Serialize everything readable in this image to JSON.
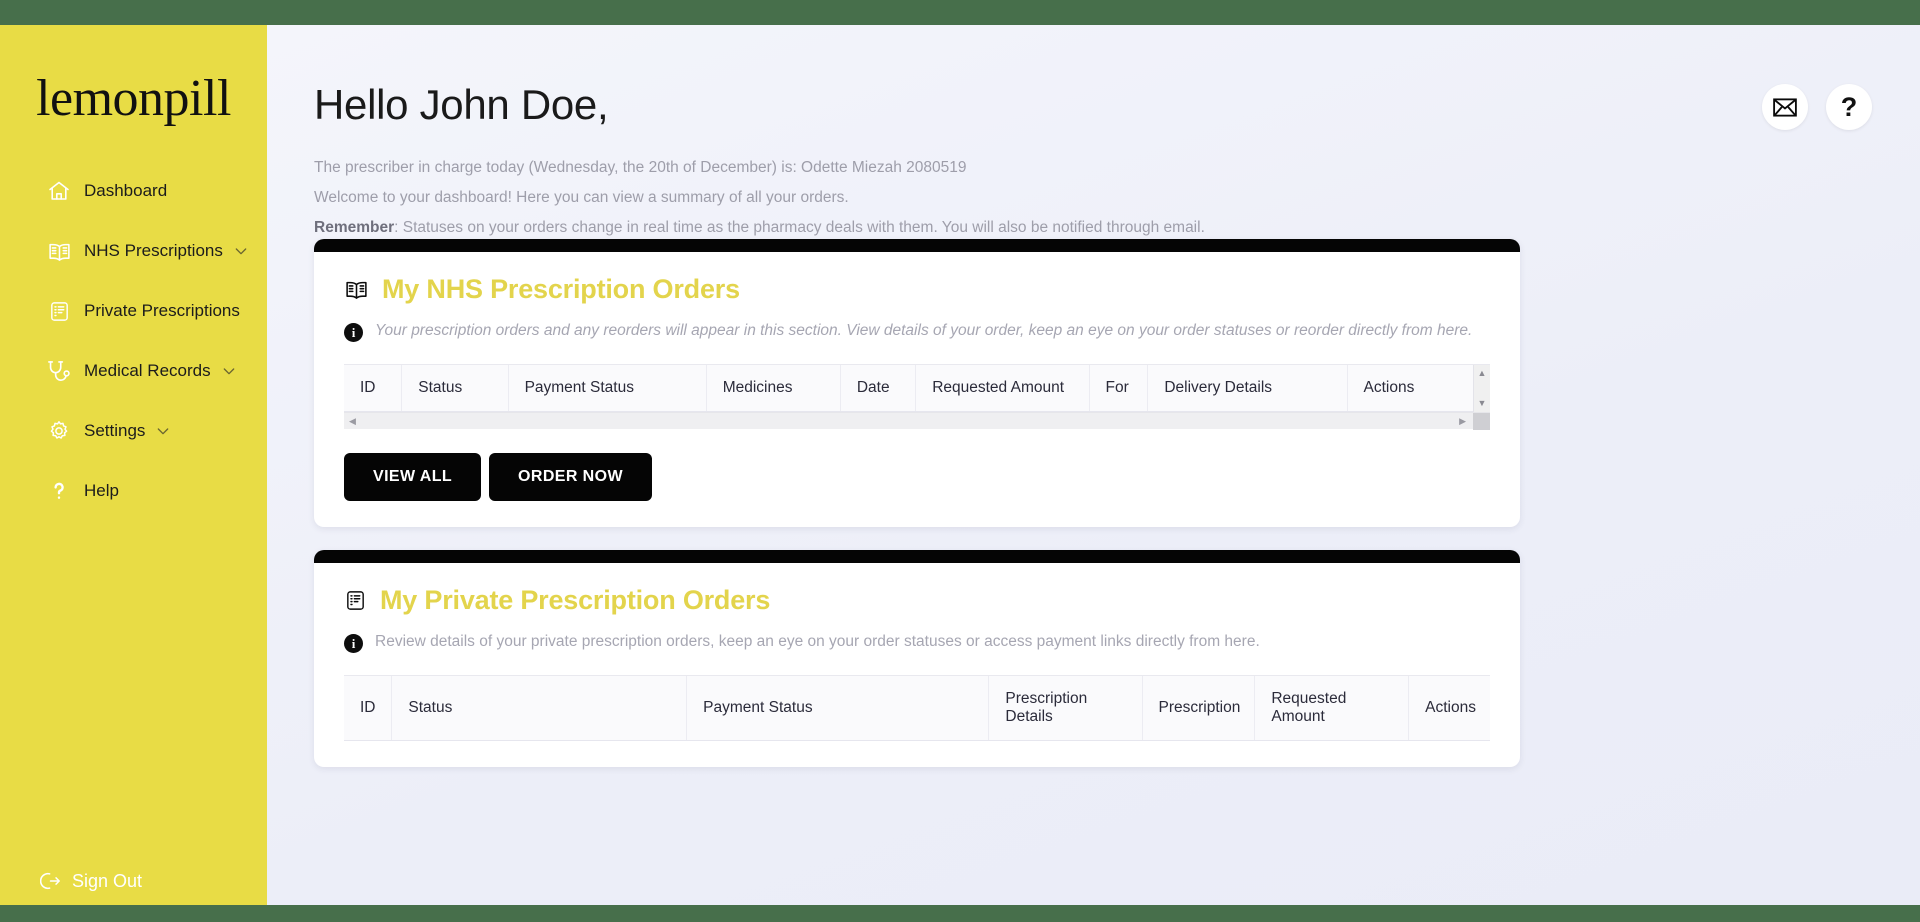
{
  "theme": {
    "band_green": "#476F4B",
    "sidebar_yellow": "#E8DC45",
    "accent_yellow": "#E3D44C",
    "main_bg": "#EEF0F8",
    "card_bar_black": "#050505"
  },
  "sidebar": {
    "logo": "lemonpill",
    "items": [
      {
        "label": "Dashboard",
        "icon": "home-icon",
        "chevron": false
      },
      {
        "label": "NHS Prescriptions",
        "icon": "open-book-icon",
        "chevron": true
      },
      {
        "label": "Private Prescriptions",
        "icon": "document-icon",
        "chevron": false
      },
      {
        "label": "Medical Records",
        "icon": "stethoscope-icon",
        "chevron": true
      },
      {
        "label": "Settings",
        "icon": "gear-icon",
        "chevron": true
      },
      {
        "label": "Help",
        "icon": "question-mark-icon",
        "chevron": false
      }
    ],
    "sign_out": "Sign Out"
  },
  "header": {
    "greeting": "Hello John Doe,",
    "prescriber_line": "The prescriber in charge today (Wednesday, the 20th of December) is: Odette Miezah 2080519",
    "welcome_line": "Welcome to your dashboard! Here you can view a summary of all your orders.",
    "remember_label": "Remember",
    "remember_line": ": Statuses on your orders change in real time as the pharmacy deals with them. You will also be notified through email.",
    "mail_icon": "envelope-icon",
    "help_icon": "question-mark-icon"
  },
  "nhs_card": {
    "title": "My NHS Prescription Orders",
    "title_icon": "open-book-icon",
    "note": "Your prescription orders and any reorders will appear in this section. View details of your order, keep an eye on your order statuses or reorder directly from here.",
    "columns": [
      "ID",
      "Status",
      "Payment Status",
      "Medicines",
      "Date",
      "Requested Amount",
      "For",
      "Delivery Details",
      "Actions"
    ],
    "rows": [],
    "buttons": {
      "view_all": "VIEW ALL",
      "order_now": "ORDER NOW"
    }
  },
  "private_card": {
    "title": "My Private Prescription Orders",
    "title_icon": "document-icon",
    "note": "Review details of your private prescription orders, keep an eye on your order statuses or access payment links directly from here.",
    "columns": [
      "ID",
      "Status",
      "Payment Status",
      "Prescription Details",
      "Prescription",
      "Requested Amount",
      "Actions"
    ],
    "rows": []
  }
}
